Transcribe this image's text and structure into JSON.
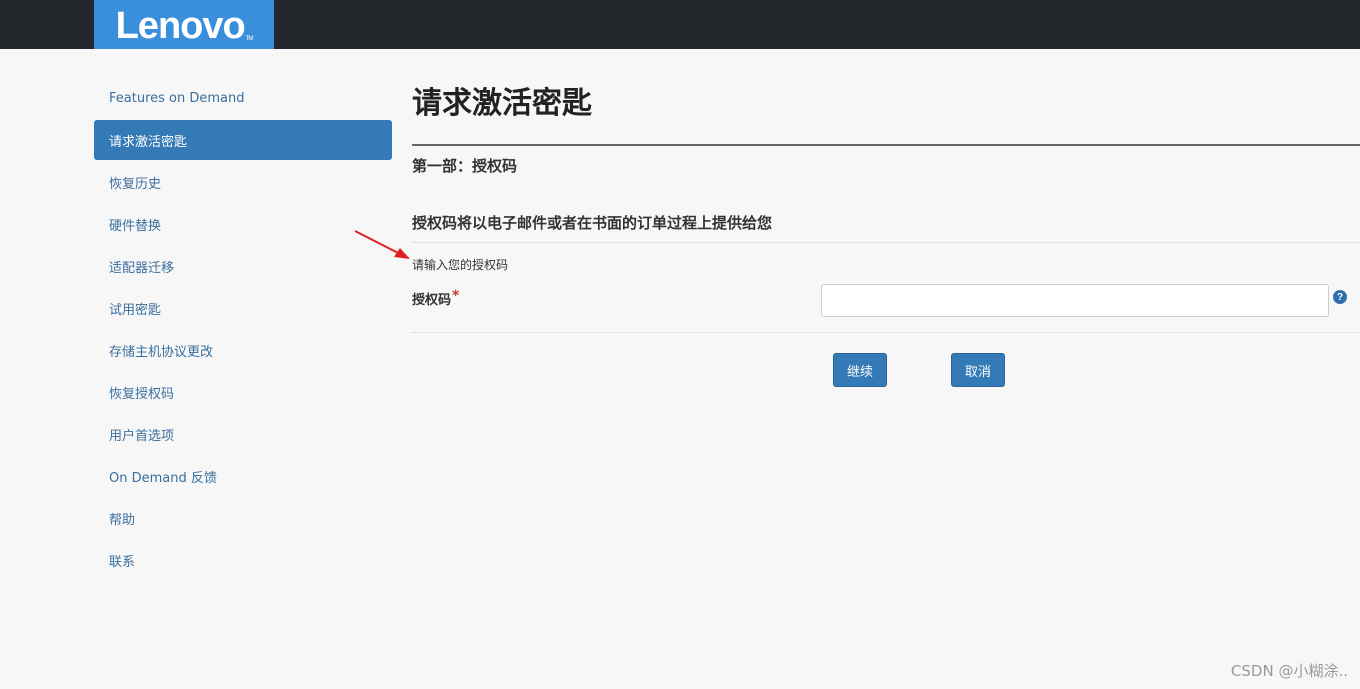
{
  "header": {
    "logo_text": "Lenovo",
    "logo_tm": "TM",
    "bar_color": "#24272b",
    "logo_color": "#3a8fdd"
  },
  "sidebar": {
    "items": [
      {
        "label": "Features on Demand",
        "active": false
      },
      {
        "label": "请求激活密匙",
        "active": true
      },
      {
        "label": "恢复历史",
        "active": false
      },
      {
        "label": "硬件替换",
        "active": false
      },
      {
        "label": "适配器迁移",
        "active": false
      },
      {
        "label": "试用密匙",
        "active": false
      },
      {
        "label": "存储主机协议更改",
        "active": false
      },
      {
        "label": "恢复授权码",
        "active": false
      },
      {
        "label": "用户首选项",
        "active": false
      },
      {
        "label": "On Demand 反馈",
        "active": false
      },
      {
        "label": "帮助",
        "active": false
      },
      {
        "label": "联系",
        "active": false
      }
    ],
    "active_color": "#337ab7",
    "link_color": "#3a6f9e"
  },
  "main": {
    "page_title": "请求激活密匙",
    "section_title": "第一部：授权码",
    "sub_title": "授权码将以电子邮件或者在书面的订单过程上提供给您",
    "hint": "请输入您的授权码",
    "field_label": "授权码",
    "required_mark": "*",
    "auth_code_value": "",
    "help_glyph": "?",
    "continue_label": "继续",
    "cancel_label": "取消"
  },
  "annotation": {
    "arrow_color": "#e02020"
  },
  "watermark": {
    "text": "CSDN @小糊涂.."
  }
}
